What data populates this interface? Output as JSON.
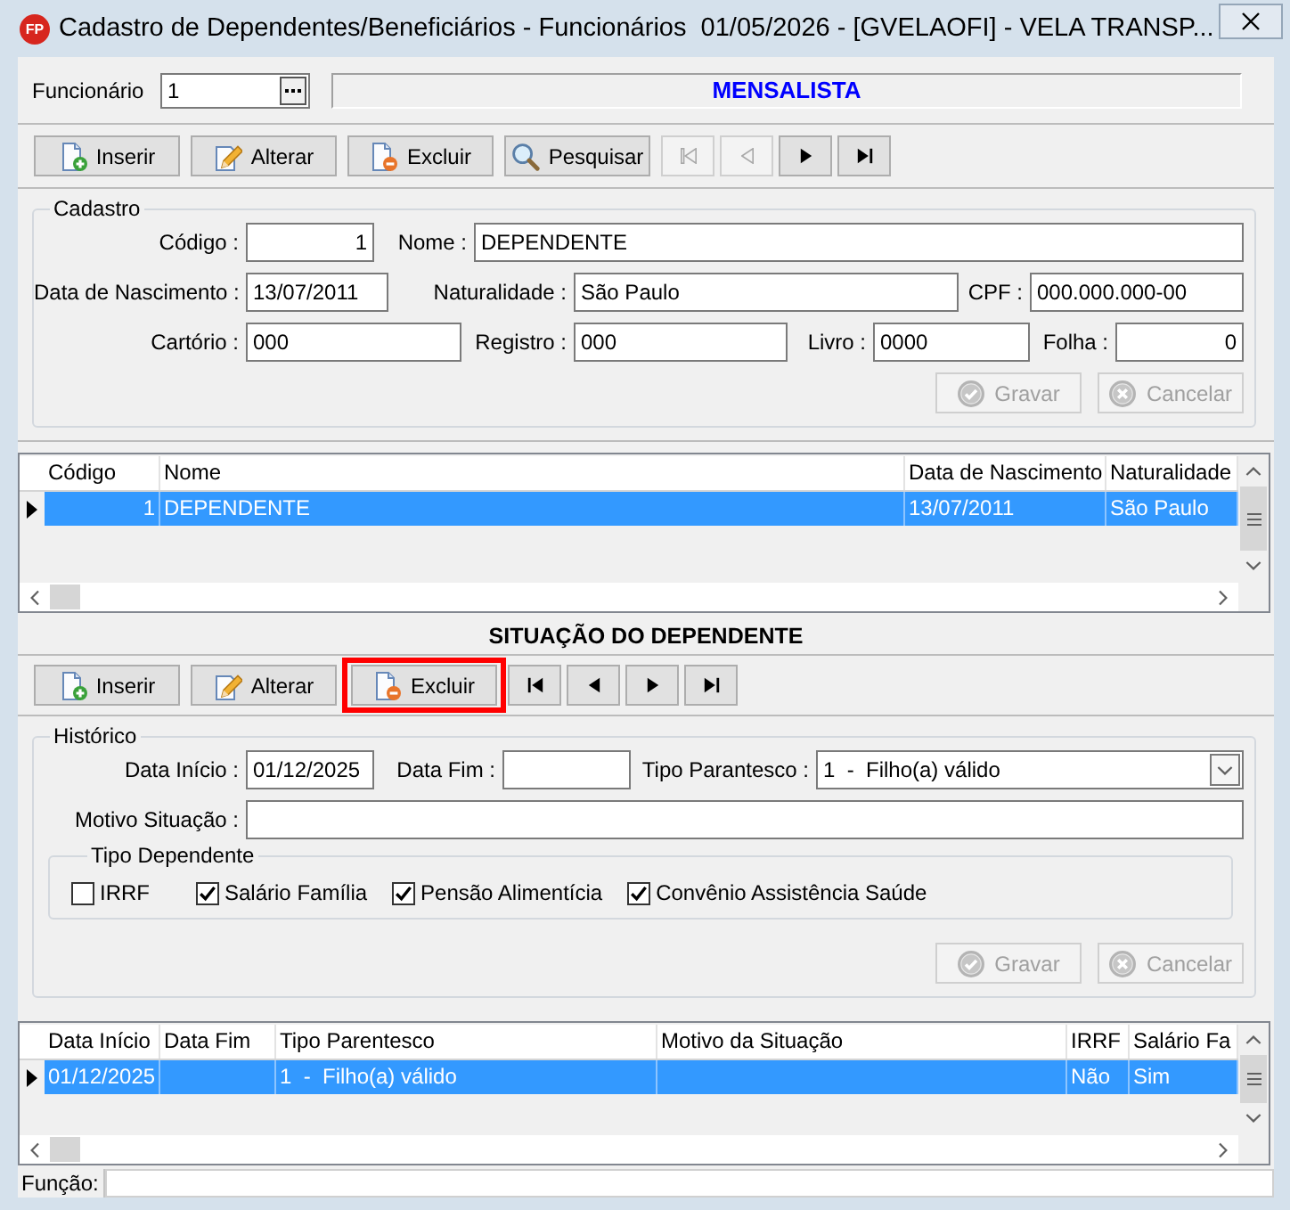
{
  "window": {
    "logo": "FP",
    "title": "Cadastro de Dependentes/Beneficiários - Funcionários  01/05/2026 - [GVELAOFI] - VELA TRANSP..."
  },
  "funcionario": {
    "label": "Funcionário",
    "value": "1",
    "category": "MENSALISTA"
  },
  "toolbar": [
    {
      "kind": "insert",
      "label": "Inserir",
      "disabled": false
    },
    {
      "kind": "edit",
      "label": "Alterar",
      "disabled": false
    },
    {
      "kind": "delete",
      "label": "Excluir",
      "disabled": false
    },
    {
      "kind": "search",
      "label": "Pesquisar",
      "disabled": false
    },
    {
      "kind": "first",
      "disabled": true
    },
    {
      "kind": "prev",
      "disabled": true
    },
    {
      "kind": "next",
      "disabled": false
    },
    {
      "kind": "last",
      "disabled": false
    }
  ],
  "cadastro": {
    "title": "Cadastro",
    "lines": [
      {
        "fields": [
          {
            "label": "Código :",
            "value": "1",
            "kind": "number"
          },
          {
            "label": "Nome :",
            "value": "DEPENDENTE",
            "kind": "text"
          }
        ]
      },
      {
        "fields": [
          {
            "label": "Data de Nascimento :",
            "value": "13/07/2011",
            "kind": "text"
          },
          {
            "label": "Naturalidade :",
            "value": "São Paulo",
            "kind": "text"
          },
          {
            "label": "CPF :",
            "value": "000.000.000-00",
            "kind": "text"
          }
        ]
      },
      {
        "fields": [
          {
            "label": "Cartório :",
            "value": "000",
            "kind": "text"
          },
          {
            "label": "Registro :",
            "value": "000",
            "kind": "text"
          },
          {
            "label": "Livro :",
            "value": "0000",
            "kind": "text"
          },
          {
            "label": "Folha :",
            "value": "0",
            "kind": "number"
          }
        ]
      }
    ],
    "buttons": [
      {
        "kind": "save",
        "label": "Gravar",
        "disabled": true
      },
      {
        "kind": "cancel",
        "label": "Cancelar",
        "disabled": true
      }
    ]
  },
  "dependents_table": {
    "columns": [
      {
        "label": "Código",
        "kind": "number"
      },
      {
        "label": "Nome",
        "kind": "text"
      },
      {
        "label": "Data de Nascimento",
        "kind": "text"
      },
      {
        "label": "Naturalidade",
        "kind": "text"
      }
    ],
    "rows": [
      {
        "selected": true,
        "cells": [
          "1",
          "DEPENDENTE",
          "13/07/2011",
          "São Paulo"
        ]
      }
    ]
  },
  "situacao": {
    "title": "SITUAÇÃO DO DEPENDENTE",
    "toolbar": [
      {
        "kind": "insert",
        "label": "Inserir",
        "disabled": false,
        "highlighted": false
      },
      {
        "kind": "edit",
        "label": "Alterar",
        "disabled": false,
        "highlighted": false
      },
      {
        "kind": "delete",
        "label": "Excluir",
        "disabled": false,
        "highlighted": true
      },
      {
        "kind": "first",
        "disabled": false,
        "highlighted": false
      },
      {
        "kind": "prev",
        "disabled": false,
        "highlighted": false
      },
      {
        "kind": "next",
        "disabled": false,
        "highlighted": false
      },
      {
        "kind": "last",
        "disabled": false,
        "highlighted": false
      }
    ]
  },
  "historico": {
    "title": "Histórico",
    "lines": [
      {
        "fields": [
          {
            "label": "Data Início :",
            "value": "01/12/2025",
            "kind": "text"
          },
          {
            "label": "Data Fim :",
            "kind": "text"
          },
          {
            "label": "Tipo Parantesco :",
            "value": "1  -  Filho(a) válido",
            "kind": "select"
          }
        ]
      },
      {
        "fields": [
          {
            "label": "Motivo Situação :",
            "kind": "text"
          }
        ]
      }
    ],
    "tipo_dependente": {
      "title": "Tipo Dependente",
      "options": [
        {
          "label": "IRRF",
          "checked": false
        },
        {
          "label": "Salário Família",
          "checked": true
        },
        {
          "label": "Pensão Alimentícia",
          "checked": true
        },
        {
          "label": "Convênio Assistência Saúde",
          "checked": true
        }
      ]
    },
    "buttons": [
      {
        "kind": "save",
        "label": "Gravar",
        "disabled": true
      },
      {
        "kind": "cancel",
        "label": "Cancelar",
        "disabled": true
      }
    ]
  },
  "history_table": {
    "columns": [
      {
        "label": "Data Início"
      },
      {
        "label": "Data Fim"
      },
      {
        "label": "Tipo Parentesco"
      },
      {
        "label": "Motivo da Situação"
      },
      {
        "label": "IRRF"
      },
      {
        "label": "Salário Fa"
      }
    ],
    "rows": [
      {
        "selected": true,
        "cells": [
          "01/12/2025",
          null,
          "1  -  Filho(a) válido",
          null,
          "Não",
          "Sim"
        ]
      }
    ]
  },
  "status_bar": {
    "label": "Função:"
  }
}
